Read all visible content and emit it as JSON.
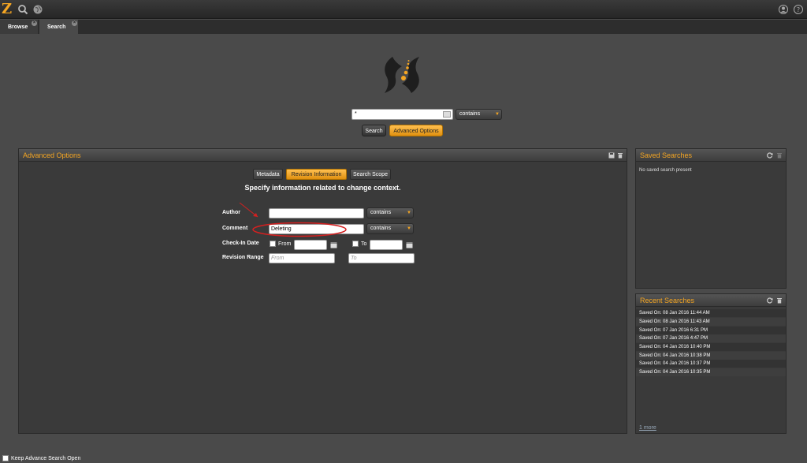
{
  "topbar": {
    "logo": "Z",
    "icons": [
      "search-icon",
      "globe-icon",
      "user-icon",
      "help-icon"
    ]
  },
  "tabs": [
    {
      "label": "Browse",
      "active": false
    },
    {
      "label": "Search",
      "active": true
    }
  ],
  "search": {
    "query": "*",
    "operator": "contains",
    "search_button": "Search",
    "advanced_button": "Advanced Options"
  },
  "advanced": {
    "title": "Advanced Options",
    "sub_tabs": [
      "Metadata",
      "Revision Information",
      "Search Scope"
    ],
    "active_sub_tab": "Revision Information",
    "heading": "Specify information related to change context.",
    "fields": {
      "author_label": "Author",
      "author_value": "",
      "author_operator": "contains",
      "comment_label": "Comment",
      "comment_value": "Deleting",
      "comment_operator": "contains",
      "checkin_label": "Check-In Date",
      "from_label": "From",
      "to_label": "To",
      "revision_label": "Revision Range",
      "revision_from_placeholder": "From",
      "revision_to_placeholder": "To"
    }
  },
  "saved_searches": {
    "title": "Saved Searches",
    "empty_text": "No saved search present"
  },
  "recent_searches": {
    "title": "Recent Searches",
    "items": [
      "Saved On: 08 Jan 2016 11:44 AM",
      "Saved On: 08 Jan 2016 11:43 AM",
      "Saved On: 07 Jan 2016 6:31 PM",
      "Saved On: 07 Jan 2016 4:47 PM",
      "Saved On: 04 Jan 2016 10:40 PM",
      "Saved On: 04 Jan 2016 10:38 PM",
      "Saved On: 04 Jan 2016 10:37 PM",
      "Saved On: 04 Jan 2016 10:35 PM"
    ],
    "more_link": "1 more"
  },
  "footer": {
    "keep_open_label": "Keep Advance Search Open"
  },
  "colors": {
    "accent": "#f5a623",
    "background": "#4a4a4a",
    "panel": "#3a3a3a"
  }
}
